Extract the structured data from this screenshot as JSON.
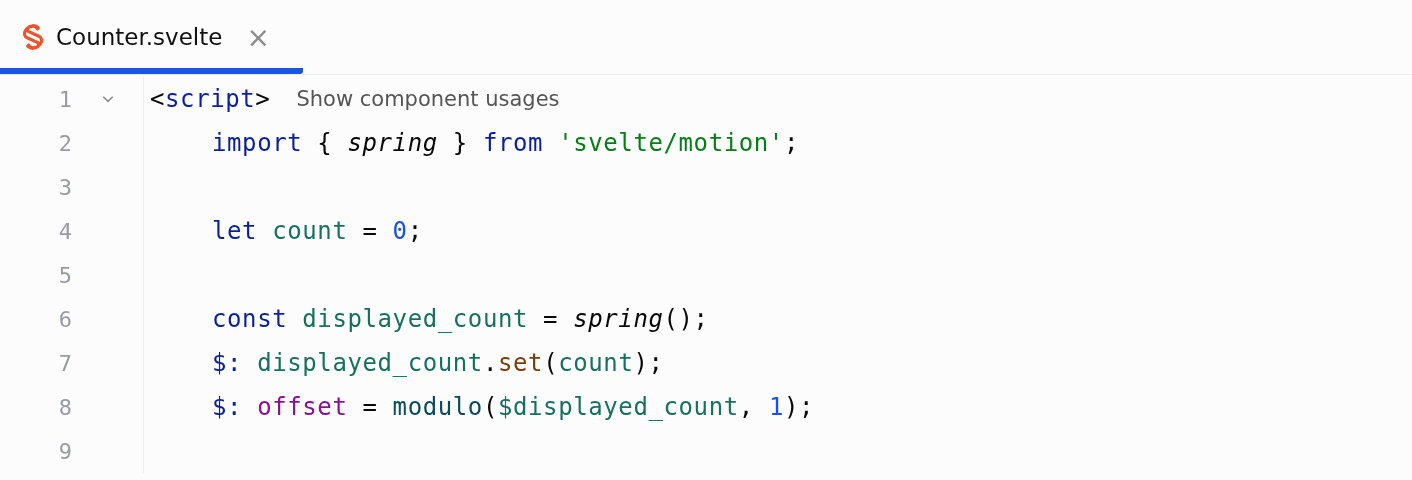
{
  "tabs": [
    {
      "label": "Counter.svelte",
      "selected": true,
      "close": "×"
    }
  ],
  "lines": [
    {
      "number": "1",
      "expanded": true,
      "hint": "Show component usages",
      "tokens": [
        {
          "kind": "punct",
          "text": "<"
        },
        {
          "kind": "tag",
          "text": "script"
        },
        {
          "kind": "punct",
          "text": ">"
        }
      ],
      "children": [
        {
          "number": "2",
          "tokens": [
            {
              "kind": "keyword",
              "text": "import"
            },
            {
              "kind": "punct",
              "text": " { "
            },
            {
              "kind": "italic",
              "text": "spring"
            },
            {
              "kind": "punct",
              "text": " } "
            },
            {
              "kind": "keyword",
              "text": "from "
            },
            {
              "kind": "string",
              "text": "'svelte/motion'"
            },
            {
              "kind": "punct",
              "text": ";"
            }
          ]
        },
        {
          "number": "3"
        },
        {
          "number": "4",
          "tokens": [
            {
              "kind": "keyword",
              "text": "let "
            },
            {
              "kind": "variable",
              "text": "count"
            },
            {
              "kind": "punct",
              "text": " = "
            },
            {
              "kind": "number",
              "text": "0"
            },
            {
              "kind": "punct",
              "text": ";"
            }
          ]
        },
        {
          "number": "5"
        },
        {
          "number": "6",
          "tokens": [
            {
              "kind": "keyword",
              "text": "const "
            },
            {
              "kind": "variable",
              "text": "displayed_count"
            },
            {
              "kind": "punct",
              "text": " = "
            },
            {
              "kind": "italic",
              "text": "spring"
            },
            {
              "kind": "punct",
              "text": "();"
            }
          ]
        },
        {
          "number": "7",
          "tokens": [
            {
              "kind": "keyword",
              "text": "$: "
            },
            {
              "kind": "variable",
              "text": "displayed_count"
            },
            {
              "kind": "punct",
              "text": "."
            },
            {
              "kind": "method",
              "text": "set"
            },
            {
              "kind": "punct",
              "text": "("
            },
            {
              "kind": "variable",
              "text": "count"
            },
            {
              "kind": "punct",
              "text": ");"
            }
          ]
        },
        {
          "number": "8",
          "tokens": [
            {
              "kind": "keyword",
              "text": "$: "
            },
            {
              "kind": "field",
              "text": "offset"
            },
            {
              "kind": "punct",
              "text": " = "
            },
            {
              "kind": "function",
              "text": "modulo"
            },
            {
              "kind": "punct",
              "text": "("
            },
            {
              "kind": "variable",
              "text": "$displayed_count"
            },
            {
              "kind": "punct",
              "text": ", "
            },
            {
              "kind": "number",
              "text": "1"
            },
            {
              "kind": "punct",
              "text": ");"
            }
          ]
        },
        {
          "number": "9"
        }
      ]
    }
  ]
}
